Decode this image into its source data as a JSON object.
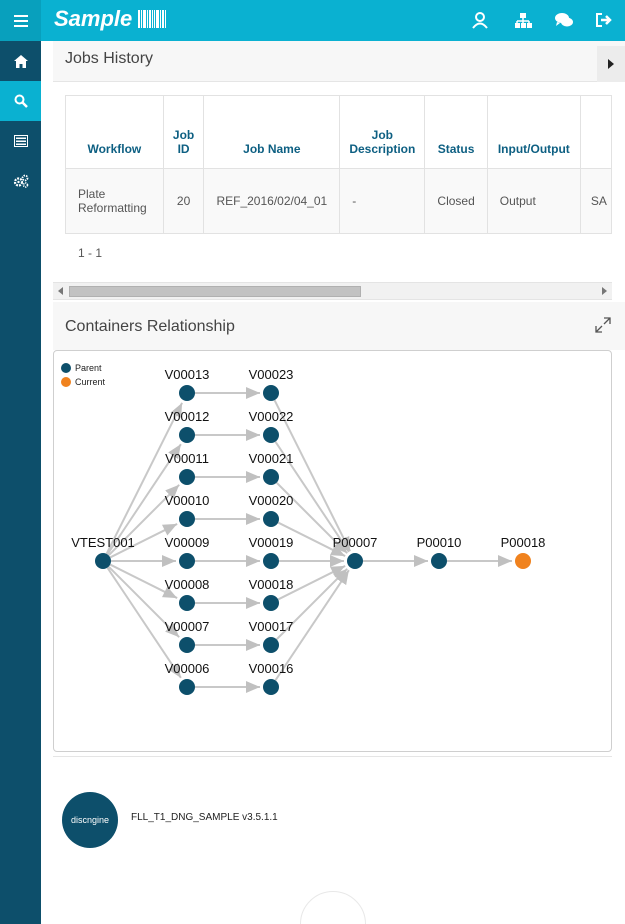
{
  "app": {
    "brand": "Sample",
    "accent_color": "#0ab1d1",
    "sidebar_color": "#0d4f6b"
  },
  "topbar": {
    "icons": [
      "user-icon",
      "sitemap-icon",
      "chat-icon",
      "logout-icon"
    ]
  },
  "sidebar": {
    "items": [
      {
        "icon": "home-icon"
      },
      {
        "icon": "search-icon"
      },
      {
        "icon": "list-icon"
      },
      {
        "icon": "cogs-icon"
      }
    ]
  },
  "jobs_history": {
    "title": "Jobs History",
    "columns": [
      "Workflow",
      "Job ID",
      "Job Name",
      "Job Description",
      "Status",
      "Input/Output",
      ""
    ],
    "rows": [
      [
        "Plate Reformatting",
        "20",
        "REF_2016/02/04_01",
        "-",
        "Closed",
        "Output",
        "SA"
      ]
    ],
    "pagination": "1 - 1"
  },
  "containers": {
    "title": "Containers Relationship",
    "legend": [
      {
        "label": "Parent",
        "color": "#0d4f6b"
      },
      {
        "label": "Current",
        "color": "#f0821e"
      }
    ],
    "nodes": {
      "root": "VTEST001",
      "col1": [
        "V00013",
        "V00012",
        "V00011",
        "V00010",
        "V00009",
        "V00008",
        "V00007",
        "V00006"
      ],
      "col2": [
        "V00023",
        "V00022",
        "V00021",
        "V00020",
        "V00019",
        "V00018",
        "V00017",
        "V00016"
      ],
      "chain": [
        "P00007",
        "P00010",
        "P00018"
      ]
    }
  },
  "footer": {
    "logo_text": "discngine",
    "version": "FLL_T1_DNG_SAMPLE v3.5.1.1"
  }
}
